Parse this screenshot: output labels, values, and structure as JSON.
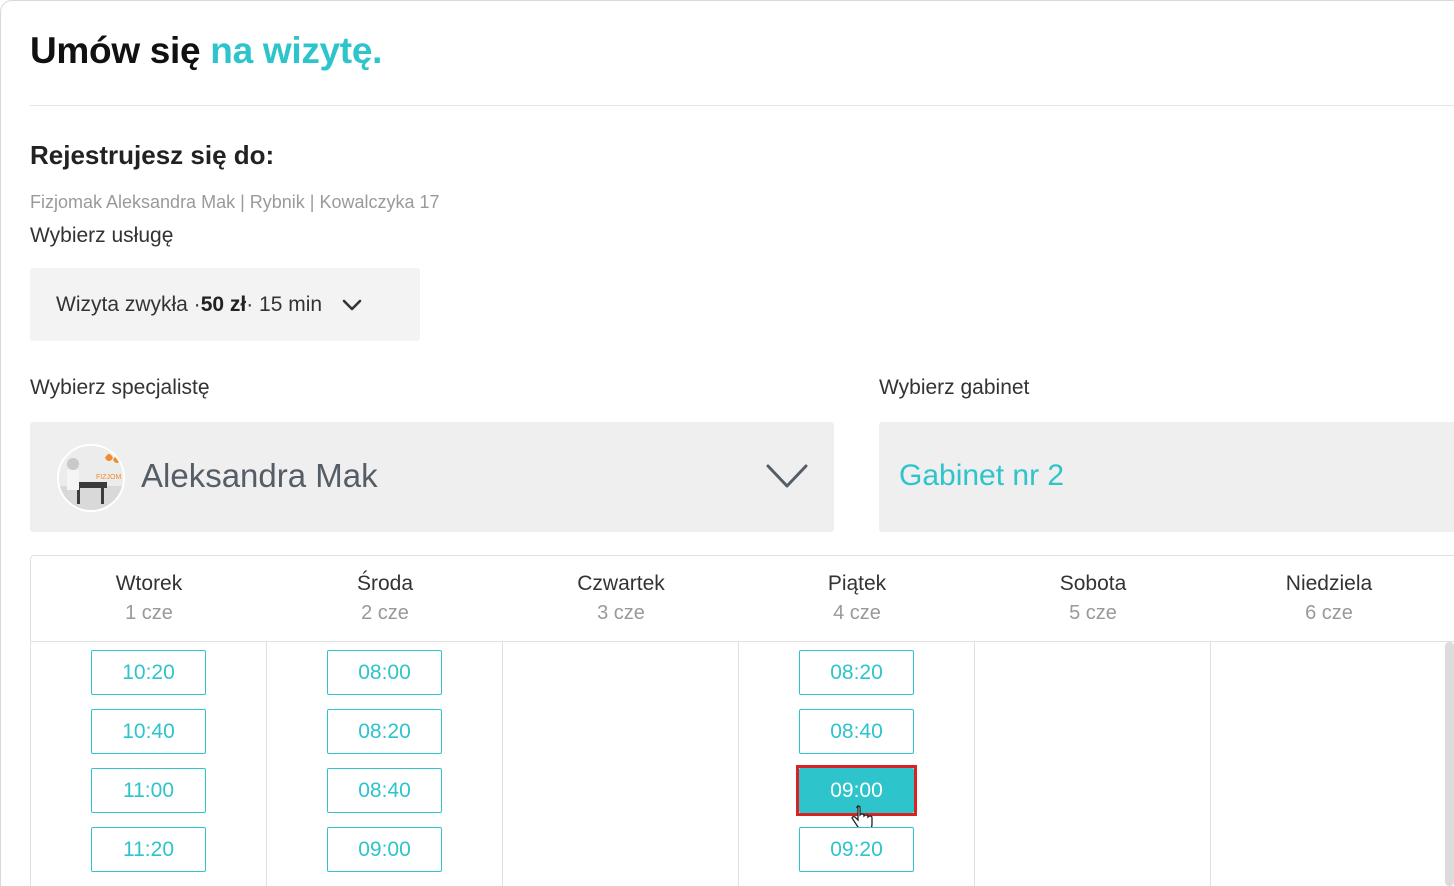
{
  "header": {
    "title_prefix": "Umów się ",
    "title_accent": "na wizytę."
  },
  "registration": {
    "heading": "Rejestrujesz się do:",
    "clinic": "Fizjomak Aleksandra Mak | Rybnik | Kowalczyka 17"
  },
  "service": {
    "label": "Wybierz usługę",
    "name": "Wizyta zwykła · ",
    "price": "50 zł",
    "duration": " · 15 min"
  },
  "specialist": {
    "label": "Wybierz specjalistę",
    "name": "Aleksandra Mak",
    "avatar_text": "FIZJOM"
  },
  "room": {
    "label": "Wybierz gabinet",
    "name": "Gabinet nr 2"
  },
  "calendar": {
    "days": [
      {
        "name": "Wtorek",
        "date": "1 cze",
        "slots": [
          "10:20",
          "10:40",
          "11:00",
          "11:20"
        ]
      },
      {
        "name": "Środa",
        "date": "2 cze",
        "slots": [
          "08:00",
          "08:20",
          "08:40",
          "09:00"
        ]
      },
      {
        "name": "Czwartek",
        "date": "3 cze",
        "slots": []
      },
      {
        "name": "Piątek",
        "date": "4 cze",
        "slots": [
          "08:20",
          "08:40",
          "09:00",
          "09:20"
        ]
      },
      {
        "name": "Sobota",
        "date": "5 cze",
        "slots": []
      },
      {
        "name": "Niedziela",
        "date": "6 cze",
        "slots": []
      }
    ],
    "selected": {
      "day": 3,
      "slot": 2
    }
  },
  "colors": {
    "accent": "#2ec4cc",
    "highlight": "#d72323"
  },
  "icons": [
    "chevron-down-icon",
    "hand-pointer-icon"
  ]
}
